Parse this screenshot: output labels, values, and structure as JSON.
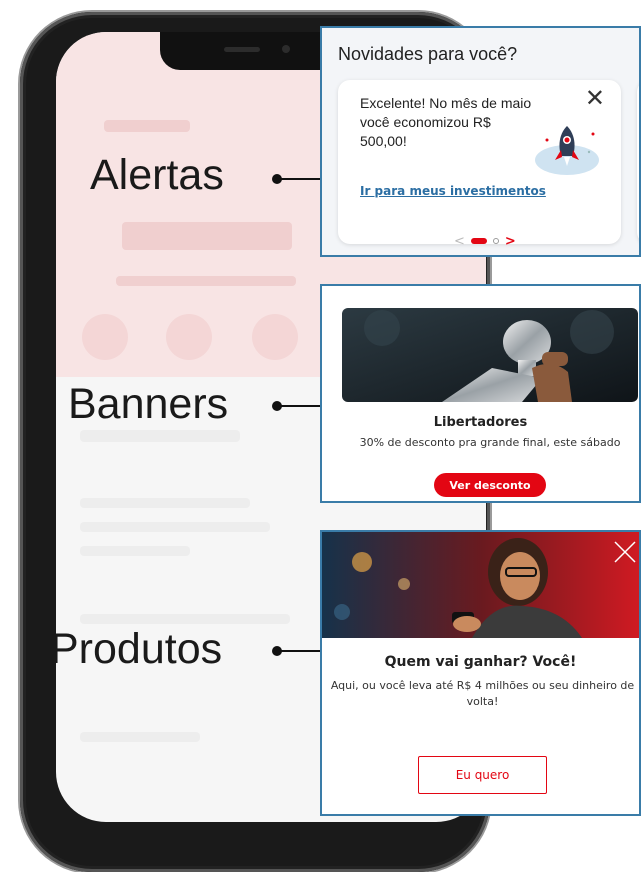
{
  "labels": {
    "alertas": "Alertas",
    "banners": "Banners",
    "produtos": "Produtos"
  },
  "alerts_card": {
    "title": "Novidades para você?",
    "message": "Excelente! No mês de maio você economizou R$ 500,00!",
    "link": "Ir para meus investimentos",
    "close_icon": "close-icon",
    "illustration": "rocket-icon",
    "pager": {
      "total": 2,
      "active": 1
    }
  },
  "banner_card": {
    "title": "Libertadores",
    "subtitle": "30% de desconto pra grande final, este sábado",
    "button": "Ver desconto",
    "image": "trophy-photo"
  },
  "product_card": {
    "title": "Quem vai ganhar? Você!",
    "description": "Aqui, ou você leva até R$ 4 milhões ou seu dinheiro de volta!",
    "button": "Eu quero",
    "close_icon": "close-icon",
    "image": "woman-with-phone-photo"
  },
  "colors": {
    "brand_red": "#e30613",
    "link_blue": "#2b6ea3",
    "card_border": "#3a7ca8"
  }
}
